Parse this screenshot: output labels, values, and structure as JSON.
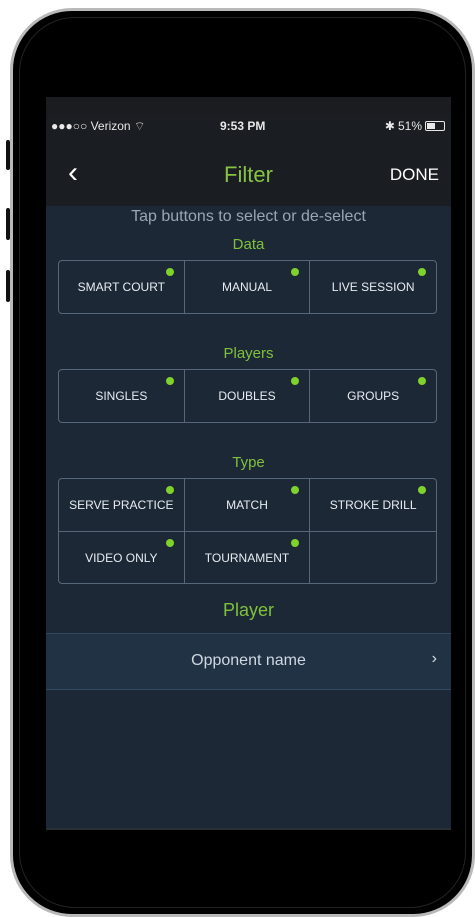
{
  "status": {
    "carrier": "●●●○○ Verizon",
    "wifi": "wifi-icon",
    "time": "9:53 PM",
    "bluetooth": "bluetooth-icon",
    "battery": "51%"
  },
  "nav": {
    "title": "Filter",
    "done": "DONE"
  },
  "hint": "Tap buttons to select or de-select",
  "sections": {
    "data": {
      "label": "Data",
      "items": [
        {
          "label": "SMART COURT",
          "selected": true
        },
        {
          "label": "MANUAL",
          "selected": true
        },
        {
          "label": "LIVE SESSION",
          "selected": true
        }
      ]
    },
    "players": {
      "label": "Players",
      "items": [
        {
          "label": "SINGLES",
          "selected": true
        },
        {
          "label": "DOUBLES",
          "selected": true
        },
        {
          "label": "GROUPS",
          "selected": true
        }
      ]
    },
    "type": {
      "label": "Type",
      "items": [
        {
          "label": "SERVE PRACTICE",
          "selected": true
        },
        {
          "label": "MATCH",
          "selected": true
        },
        {
          "label": "STROKE DRILL",
          "selected": true
        },
        {
          "label": "VIDEO ONLY",
          "selected": true
        },
        {
          "label": "TOURNAMENT",
          "selected": true
        },
        {
          "label": "",
          "selected": false
        }
      ]
    }
  },
  "player": {
    "label": "Player",
    "opponent_placeholder": "Opponent name"
  },
  "colors": {
    "accent": "#7fc13b",
    "dot": "#7fd12c",
    "background": "#1d2836"
  }
}
